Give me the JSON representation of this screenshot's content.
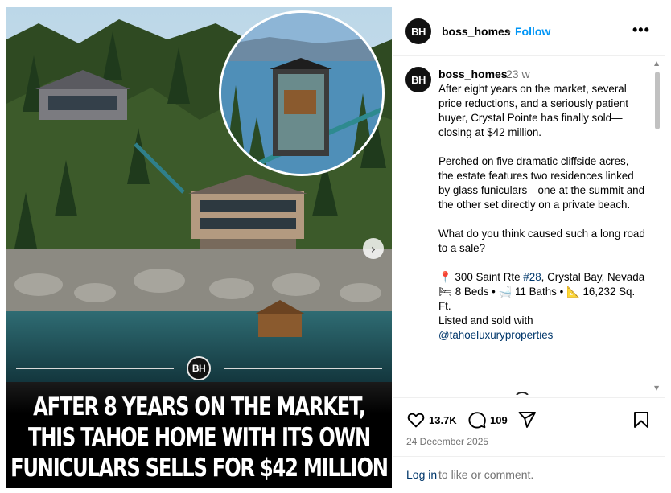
{
  "media": {
    "brand_badge": "BH",
    "headline_lines": [
      "AFTER 8 YEARS ON THE MARKET,",
      "THIS TAHOE HOME WITH ITS OWN",
      "FUNICULARS SELLS FOR $42 MILLION"
    ],
    "next_icon": "chevron-right-icon"
  },
  "header": {
    "avatar": "BH",
    "username": "boss_homes",
    "separator": "•",
    "follow": "Follow",
    "more": "•••"
  },
  "caption": {
    "avatar": "BH",
    "username": "boss_homes",
    "time": "23 w",
    "p1": "After eight years on the market, several price reductions, and a seriously patient buyer, Crystal Pointe has finally sold—closing at $42 million.",
    "p2": "Perched on five dramatic cliffside acres, the estate features two residences linked by glass funiculars—one at the summit and the other set directly on a private beach.",
    "p3": "What do you think caused such a long road to a sale?",
    "address_icon": "📍",
    "address_pre": "300 Saint Rte ",
    "address_tag": "#28",
    "address_post": ", Crystal Bay, Nevada",
    "bed_icon": "🛏",
    "beds": "8 Beds •",
    "bath_icon": "🛁",
    "baths": "11 Baths •",
    "ruler_icon": "📐",
    "sqft": "16,232 Sq. Ft.",
    "listed": "Listed and sold with",
    "mention": "@tahoeluxuryproperties"
  },
  "actions": {
    "likes": "13.7K",
    "comments": "109",
    "date": "24 December 2025"
  },
  "login": {
    "link": "Log in",
    "rest": "to like or comment."
  }
}
